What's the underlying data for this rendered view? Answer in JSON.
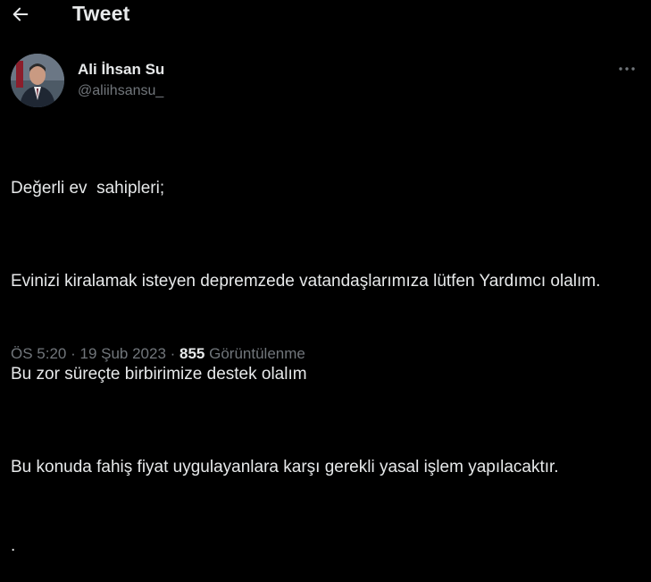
{
  "header": {
    "back_icon": "arrow-left-icon",
    "title": "Tweet"
  },
  "author": {
    "name": "Ali İhsan Su",
    "handle": "@aliihsansu_",
    "more_icon": "more-horizontal-icon"
  },
  "tweet": {
    "paragraphs": [
      "Değerli ev  sahipleri;",
      "Evinizi kiralamak isteyen depremzede vatandaşlarımıza lütfen Yardımcı olalım.",
      "Bu zor süreçte birbirimize destek olalım",
      "Bu konuda fahiş fiyat uygulayanlara karşı gerekli yasal işlem yapılacaktır."
    ],
    "trailing_dot": "."
  },
  "meta": {
    "time": "ÖS 5:20",
    "separator": " · ",
    "date": "19 Şub 2023",
    "views_count": "855",
    "views_label": "Görüntülenme"
  },
  "colors": {
    "background": "#000000",
    "text_primary": "#e7e9ea",
    "text_secondary": "#71767b"
  }
}
